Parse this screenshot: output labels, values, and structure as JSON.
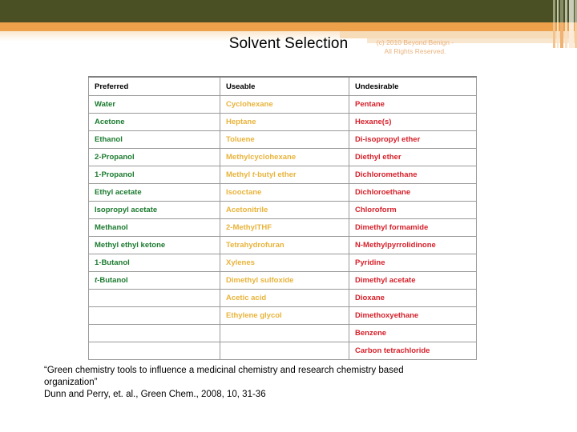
{
  "slide": {
    "title": "Solvent Selection",
    "watermark": {
      "line1": "(c) 2010 Beyond Benign -",
      "line2": "All Rights Reserved."
    }
  },
  "table": {
    "headers": [
      "Preferred",
      "Useable",
      "Undesirable"
    ],
    "colors": {
      "preferred": "#1a7a2e",
      "useable": "#e8b33a",
      "undesirable": "#d6202a",
      "header": "#000000",
      "border": "#9a9a9a"
    },
    "rows": [
      {
        "preferred": "Water",
        "useable": "Cyclohexane",
        "undesirable": "Pentane"
      },
      {
        "preferred": "Acetone",
        "useable": "Heptane",
        "undesirable": "Hexane(s)"
      },
      {
        "preferred": "Ethanol",
        "useable": "Toluene",
        "undesirable": "Di-isopropyl ether"
      },
      {
        "preferred": "2-Propanol",
        "useable": "Methylcyclohexane",
        "undesirable": "Diethyl ether"
      },
      {
        "preferred": "1-Propanol",
        "useable": "Methyl t-butyl ether",
        "undesirable": "Dichloromethane"
      },
      {
        "preferred": "Ethyl acetate",
        "useable": "Isooctane",
        "undesirable": "Dichloroethane"
      },
      {
        "preferred": "Isopropyl acetate",
        "useable": "Acetonitrile",
        "undesirable": "Chloroform"
      },
      {
        "preferred": "Methanol",
        "useable": "2-MethylTHF",
        "undesirable": "Dimethyl formamide"
      },
      {
        "preferred": "Methyl ethyl ketone",
        "useable": "Tetrahydrofuran",
        "undesirable": "N-Methylpyrrolidinone"
      },
      {
        "preferred": "1-Butanol",
        "useable": "Xylenes",
        "undesirable": "Pyridine"
      },
      {
        "preferred": "t-Butanol",
        "useable": "Dimethyl sulfoxide",
        "undesirable": "Dimethyl acetate"
      },
      {
        "preferred": "",
        "useable": "Acetic acid",
        "undesirable": "Dioxane"
      },
      {
        "preferred": "",
        "useable": "Ethylene glycol",
        "undesirable": "Dimethoxyethane"
      },
      {
        "preferred": "",
        "useable": "",
        "undesirable": "Benzene"
      },
      {
        "preferred": "",
        "useable": "",
        "undesirable": "Carbon tetrachloride"
      }
    ]
  },
  "citation": {
    "line1": "“Green chemistry tools to influence a medicinal chemistry and research chemistry based",
    "line2": "organization”",
    "line3": "Dunn and Perry, et. al., Green Chem., 2008, 10, 31-36"
  },
  "theme": {
    "band_green": "#4a5024",
    "band_orange": "#eda14a",
    "band_beige": "#f7dcba"
  }
}
